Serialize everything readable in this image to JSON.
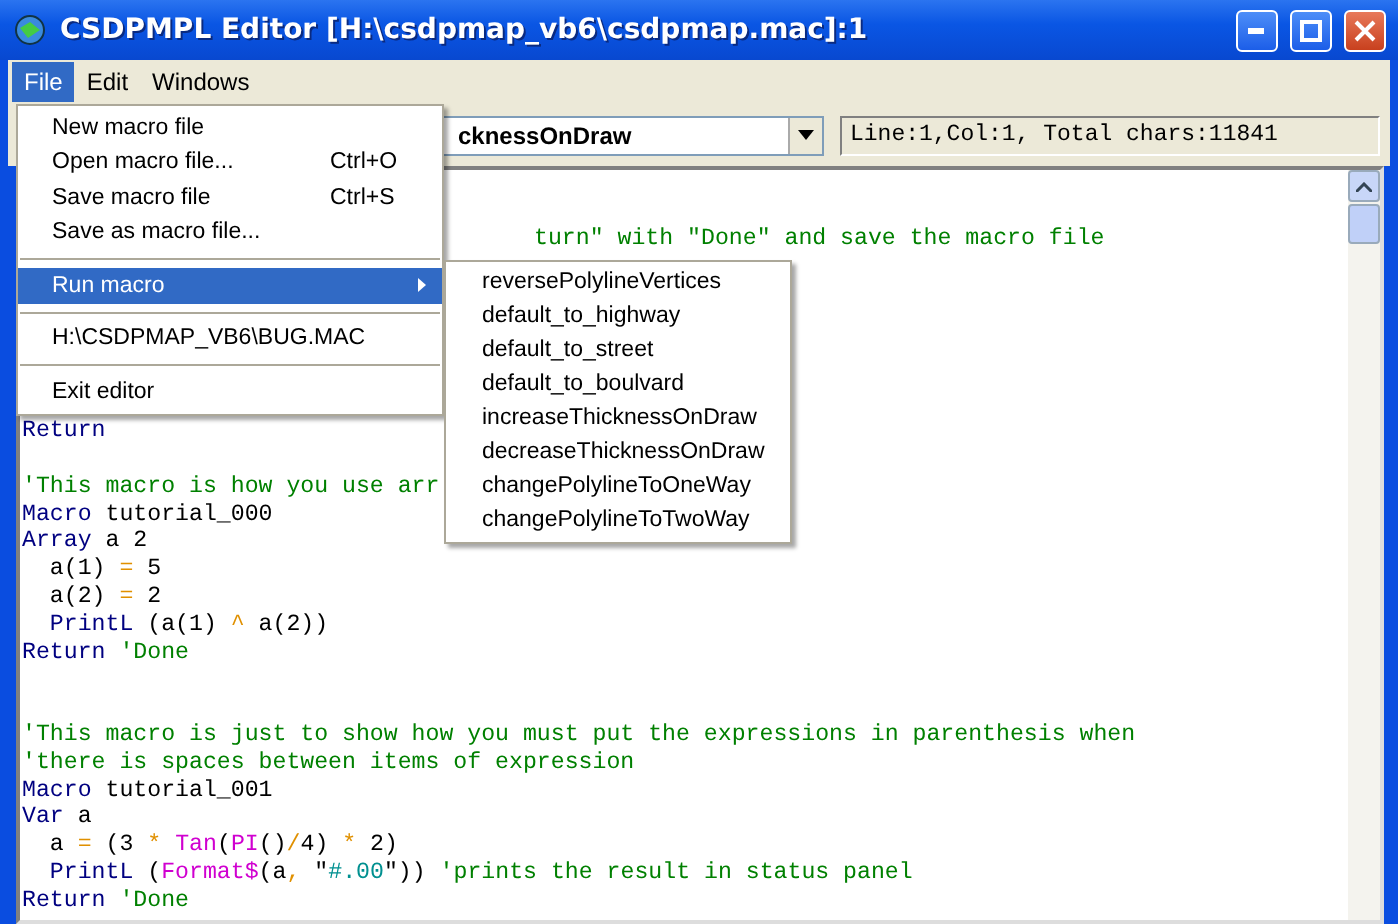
{
  "window": {
    "title": "CSDPMPL Editor [H:\\csdpmap_vb6\\csdpmap.mac]:1"
  },
  "menu_bar": [
    {
      "label": "File",
      "selected": true
    },
    {
      "label": "Edit",
      "selected": false
    },
    {
      "label": "Windows",
      "selected": false
    }
  ],
  "macro_combo": {
    "value": "cknessOnDraw"
  },
  "status_field": {
    "value": "Line:1,Col:1, Total chars:11841"
  },
  "code_lines": [
    {
      "kind": "hidden"
    },
    {
      "kind": "hidden"
    },
    {
      "kind": "partial",
      "tokens": [
        {
          "text": "turn\" with \"Done\" and save the macro file",
          "kind": "comment"
        }
      ]
    },
    {
      "kind": "hidden"
    },
    {
      "kind": "hidden"
    },
    {
      "kind": "hidden"
    },
    {
      "kind": "hidden"
    },
    {
      "kind": "hidden"
    },
    {
      "kind": "hidden"
    },
    {
      "kind": "code",
      "tokens": [
        {
          "text": "Return",
          "kind": "keyword"
        }
      ]
    },
    {
      "kind": "hidden"
    },
    {
      "kind": "code",
      "tokens": [
        {
          "text": "'This macro is how you use arr",
          "kind": "comment"
        }
      ]
    },
    {
      "kind": "code",
      "tokens": [
        {
          "text": "Macro ",
          "kind": "keyword"
        },
        {
          "text": "tutorial_000",
          "kind": "plain"
        }
      ]
    },
    {
      "kind": "code",
      "tokens": [
        {
          "text": "Array ",
          "kind": "keyword"
        },
        {
          "text": "a 2",
          "kind": "plain"
        }
      ]
    },
    {
      "kind": "code",
      "tokens": [
        {
          "text": "  a(1) ",
          "kind": "plain"
        },
        {
          "text": "=",
          "kind": "operator"
        },
        {
          "text": " 5",
          "kind": "plain"
        }
      ]
    },
    {
      "kind": "code",
      "tokens": [
        {
          "text": "  a(2) ",
          "kind": "plain"
        },
        {
          "text": "=",
          "kind": "operator"
        },
        {
          "text": " 2",
          "kind": "plain"
        }
      ]
    },
    {
      "kind": "code",
      "tokens": [
        {
          "text": "  PrintL ",
          "kind": "keyword"
        },
        {
          "text": "(a(1) ",
          "kind": "plain"
        },
        {
          "text": "^",
          "kind": "operator"
        },
        {
          "text": " a(2))",
          "kind": "plain"
        }
      ]
    },
    {
      "kind": "code",
      "tokens": [
        {
          "text": "Return ",
          "kind": "keyword"
        },
        {
          "text": "'Done",
          "kind": "comment"
        }
      ]
    },
    {
      "kind": "hidden"
    },
    {
      "kind": "hidden"
    },
    {
      "kind": "code",
      "tokens": [
        {
          "text": "'This macro is just to show how you must put the expressions in parenthesis when",
          "kind": "comment"
        }
      ]
    },
    {
      "kind": "code",
      "tokens": [
        {
          "text": "'there is spaces between items of expression",
          "kind": "comment"
        }
      ]
    },
    {
      "kind": "code",
      "tokens": [
        {
          "text": "Macro ",
          "kind": "keyword"
        },
        {
          "text": "tutorial_001",
          "kind": "plain"
        }
      ]
    },
    {
      "kind": "code",
      "tokens": [
        {
          "text": "Var ",
          "kind": "keyword"
        },
        {
          "text": "a",
          "kind": "plain"
        }
      ]
    },
    {
      "kind": "code",
      "tokens": [
        {
          "text": "  a ",
          "kind": "plain"
        },
        {
          "text": "=",
          "kind": "operator"
        },
        {
          "text": " (3 ",
          "kind": "plain"
        },
        {
          "text": "*",
          "kind": "operator"
        },
        {
          "text": " Tan",
          "kind": "function"
        },
        {
          "text": "(",
          "kind": "plain"
        },
        {
          "text": "PI",
          "kind": "function"
        },
        {
          "text": "()",
          "kind": "plain"
        },
        {
          "text": "/",
          "kind": "operator"
        },
        {
          "text": "4) ",
          "kind": "plain"
        },
        {
          "text": "*",
          "kind": "operator"
        },
        {
          "text": " 2)",
          "kind": "plain"
        }
      ]
    },
    {
      "kind": "code",
      "tokens": [
        {
          "text": "  PrintL ",
          "kind": "keyword"
        },
        {
          "text": "(",
          "kind": "plain"
        },
        {
          "text": "Format$",
          "kind": "function"
        },
        {
          "text": "(a",
          "kind": "plain"
        },
        {
          "text": ",",
          "kind": "operator"
        },
        {
          "text": " \"",
          "kind": "plain"
        },
        {
          "text": "#.00",
          "kind": "string"
        },
        {
          "text": "\")) ",
          "kind": "plain"
        },
        {
          "text": "'prints the result in status panel",
          "kind": "comment"
        }
      ]
    },
    {
      "kind": "code",
      "tokens": [
        {
          "text": "Return ",
          "kind": "keyword"
        },
        {
          "text": "'Done",
          "kind": "comment"
        }
      ]
    }
  ],
  "file_menu": [
    {
      "kind": "item",
      "label": "New macro file",
      "selected": false
    },
    {
      "kind": "item",
      "label": "Open macro file...",
      "shortcut": "Ctrl+O",
      "selected": false
    },
    {
      "kind": "item",
      "label": "Save macro file",
      "shortcut": "Ctrl+S",
      "selected": false
    },
    {
      "kind": "item",
      "label": "Save as macro file...",
      "selected": false
    },
    {
      "kind": "separator"
    },
    {
      "kind": "submenu",
      "label": "Run macro",
      "selected": true
    },
    {
      "kind": "separator"
    },
    {
      "kind": "item",
      "label": "H:\\CSDPMAP_VB6\\BUG.MAC",
      "selected": false
    },
    {
      "kind": "separator"
    },
    {
      "kind": "item",
      "label": "Exit editor",
      "selected": false
    }
  ],
  "run_macro_submenu": [
    "reversePolylineVertices",
    "default_to_highway",
    "default_to_street",
    "default_to_boulvard",
    "increaseThicknessOnDraw",
    "decreaseThicknessOnDraw",
    "changePolylineToOneWay",
    "changePolylineToTwoWay"
  ]
}
